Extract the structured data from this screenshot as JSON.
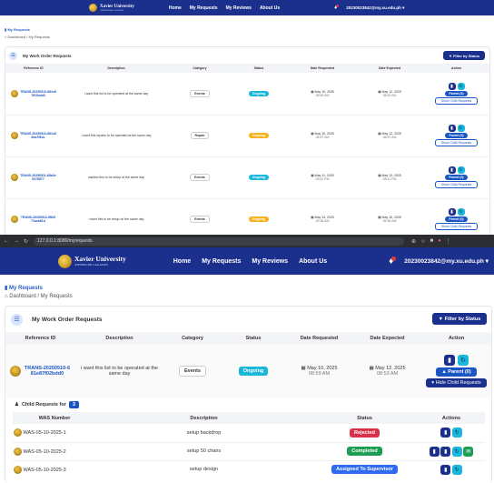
{
  "brand": {
    "name": "Xavier University",
    "sub": "ATENEO DE CAGAYAN"
  },
  "nav": {
    "home": "Home",
    "my_requests": "My Requests",
    "my_reviews": "My Reviews",
    "about": "About Us"
  },
  "user": {
    "email": "20230023842@my.xu.edu.ph",
    "notif_count": "1"
  },
  "breadcrumb": {
    "title": "My Requests",
    "dashboard": "Dashboard",
    "sep": "/",
    "current": "My Requests"
  },
  "card": {
    "title": "My Work Order Requests",
    "filter_label": "Filter by Status"
  },
  "table": {
    "headers": [
      "Reference ID",
      "Description",
      "Category",
      "Status",
      "Date Requested",
      "Date Expected",
      "Action"
    ],
    "rows": [
      {
        "ref": "TRANS-20250510-681e87f02bdd0",
        "desc": "i want this list to be operated at the same day",
        "category": "Events",
        "status": "Ongoing",
        "status_kind": "ongoing",
        "req_date": "May 10, 2025",
        "req_time": "08:59 AM",
        "exp_date": "May 12, 2025",
        "exp_time": "08:53 AM"
      },
      {
        "ref": "TRANS-20250510-681e86ba7f6dc",
        "desc": "i want this repairs to be operated at the same day",
        "category": "Repair",
        "status": "Ongoing",
        "status_kind": "stopped",
        "req_date": "May 10, 2025",
        "req_time": "08:57 AM",
        "exp_date": "May 12, 2025",
        "exp_time": "08:57 AM"
      },
      {
        "ref": "TRANS-20250511-68d4e5375877",
        "desc": "wanted this to be setup at the same day",
        "category": "Events",
        "status": "Ongoing",
        "status_kind": "ongoing",
        "req_date": "May 11, 2025",
        "req_time": "08:42 PM",
        "exp_date": "May 13, 2025",
        "exp_time": "08:41 PM"
      },
      {
        "ref": "TRANS-20250513-5f82f71aea61d",
        "desc": "i want this to be setup on the same day",
        "category": "Events",
        "status": "Ongoing",
        "status_kind": "stopped",
        "req_date": "May 13, 2025",
        "req_time": "09:38 AM",
        "exp_date": "May 15, 2025",
        "exp_time": "09:36 AM"
      }
    ],
    "parent_label": "Parent (0)",
    "show_child_label": "Show Child Requests",
    "hide_child_label": "Hide Child Requests"
  },
  "browser": {
    "url": "127.0.0.1:8080/myrequests"
  },
  "detail_row": {
    "ref": "TRANS-20250510-681e87f02bdd0",
    "desc": "i want this list to be operated at the same day",
    "category": "Events",
    "status": "Ongoing",
    "req_date": "May 10, 2025",
    "req_time": "08:59 AM",
    "exp_date": "May 12, 2025",
    "exp_time": "08:53 AM"
  },
  "child": {
    "title": "Child Requests for",
    "count": "3",
    "headers": [
      "WAS Number",
      "Description",
      "Status",
      "Actions"
    ],
    "rows": [
      {
        "was": "WAS-05-10-2025-1",
        "desc": "setup backdrop",
        "status": "Rejected"
      },
      {
        "was": "WAS-05-10-2025-2",
        "desc": "setup 50 chairs",
        "status": "Completed"
      },
      {
        "was": "WAS-05-10-2025-3",
        "desc": "setup design",
        "status": "Assigned To Supervisor"
      }
    ]
  },
  "icons": {
    "bell": "bell-icon",
    "calendar": "calendar-icon",
    "home": "home-icon",
    "trash": "trash-icon",
    "refresh": "refresh-icon",
    "chat": "chat-icon"
  },
  "colors": {
    "navbar": "#1b2f8c",
    "link": "#1a55c4",
    "ongoing": "#19b7d9",
    "stopped": "#f6b21b",
    "rejected": "#d8314a",
    "completed": "#1e9e53",
    "assigned": "#2e6bf0"
  }
}
